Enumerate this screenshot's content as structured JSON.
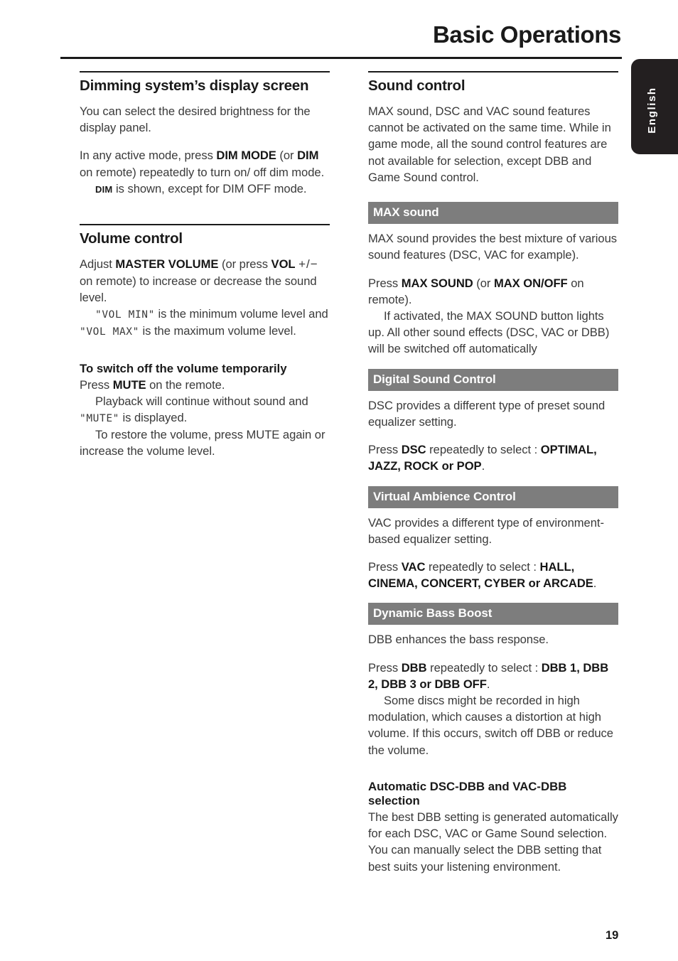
{
  "header": {
    "title": "Basic Operations",
    "language_tab": "English"
  },
  "footer": {
    "page_number": "19"
  },
  "left_column": {
    "dimming": {
      "heading": "Dimming system’s display screen",
      "p1": "You can select the desired brightness for the display panel.",
      "p2_pre": "In any active mode, press ",
      "p2_b1": "DIM MODE",
      "p2_mid": " (or ",
      "p2_b2": "DIM",
      "p2_post": " on remote) repeatedly to turn on/ off dim mode.",
      "p3_icon": "DIM",
      "p3_text": " is shown, except for DIM OFF mode."
    },
    "volume": {
      "heading": "Volume control",
      "p1_pre": "Adjust ",
      "p1_b1": "MASTER VOLUME",
      "p1_mid": " (or press ",
      "p1_b2": "VOL",
      "p1_pm": "+/−",
      "p1_post": " on remote) to increase or decrease the sound level.",
      "p2_lcd1": "\"VOL MIN\"",
      "p2_mid": " is the minimum volume level and ",
      "p2_lcd2": "\"VOL MAX\"",
      "p2_post": " is the maximum volume level.",
      "sub_heading": "To switch off the volume temporarily",
      "p3_pre": "Press ",
      "p3_b": "MUTE",
      "p3_post": " on the remote.",
      "p4_pre": "Playback will continue without sound and ",
      "p4_lcd": "\"MUTE\"",
      "p4_post": " is displayed.",
      "p5": "To restore the volume, press MUTE again or increase the volume level."
    }
  },
  "right_column": {
    "sound_control": {
      "heading": "Sound control",
      "p1": "MAX sound, DSC and VAC sound features cannot be activated on the same time. While in game mode, all the sound control features are not available for selection, except DBB and Game Sound control."
    },
    "max_sound": {
      "bar_label": "MAX sound",
      "p1": "MAX sound provides the best mixture of various sound features (DSC, VAC for example).",
      "p2_pre": "Press ",
      "p2_b1": "MAX SOUND",
      "p2_mid": " (or ",
      "p2_b2": "MAX ON/OFF",
      "p2_post": " on remote).",
      "p3": "If activated, the MAX SOUND button lights up.  All other sound effects (DSC, VAC or DBB) will be switched off automatically"
    },
    "dsc": {
      "bar_label": "Digital Sound Control",
      "p1": "DSC provides a different type of preset sound equalizer setting.",
      "p2_pre": "Press ",
      "p2_b": "DSC",
      "p2_mid": " repeatedly to select : ",
      "p2_options": "OPTIMAL, JAZZ, ROCK or POP",
      "p2_post": "."
    },
    "vac": {
      "bar_label": "Virtual Ambience Control",
      "p1": "VAC provides a different type of environment-based equalizer setting.",
      "p2_pre": "Press ",
      "p2_b": "VAC",
      "p2_mid": " repeatedly to select : ",
      "p2_options": "HALL, CINEMA, CONCERT, CYBER or ARCADE",
      "p2_post": "."
    },
    "dbb": {
      "bar_label": "Dynamic Bass Boost",
      "p1": "DBB enhances the bass response.",
      "p2_pre": "Press ",
      "p2_b": "DBB",
      "p2_mid": " repeatedly to select : ",
      "p2_options": "DBB 1, DBB 2, DBB 3 or DBB OFF",
      "p2_post": ".",
      "p3": "Some discs might be recorded in high modulation, which causes a distortion at high volume. If this occurs, switch off DBB or reduce the volume."
    },
    "auto_selection": {
      "sub_heading": "Automatic DSC-DBB and  VAC-DBB selection",
      "p1": "The best DBB setting is generated automatically for each DSC, VAC or Game Sound selection. You can manually select the DBB setting that best suits your listening environment."
    }
  },
  "colors": {
    "section_bar": "#7d7d7d",
    "tab_background": "#231f20",
    "text": "#3a3a3a"
  }
}
